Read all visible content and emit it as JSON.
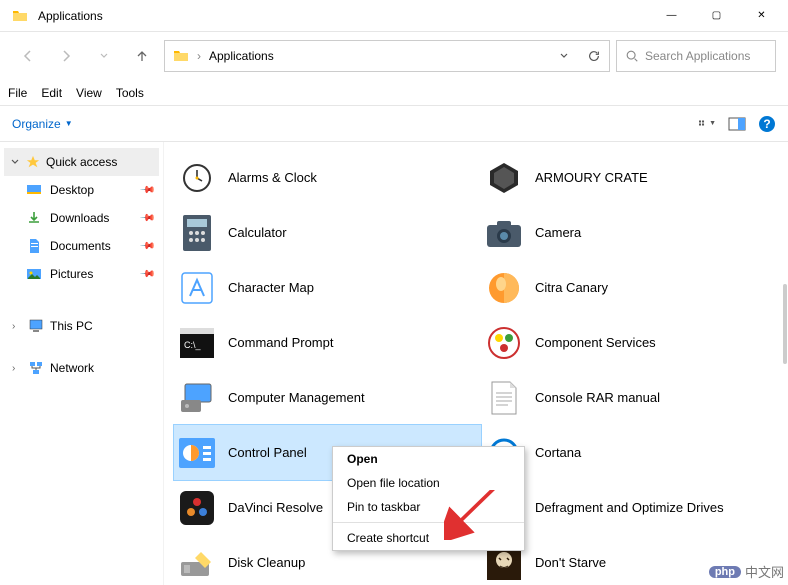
{
  "window": {
    "title": "Applications",
    "minimize": "—",
    "maximize": "▢",
    "close": "✕"
  },
  "nav": {
    "address": "Applications",
    "search_placeholder": "Search Applications"
  },
  "menu": [
    "File",
    "Edit",
    "View",
    "Tools"
  ],
  "toolbar": {
    "organize": "Organize"
  },
  "sidebar": {
    "quick_access": "Quick access",
    "items": [
      {
        "label": "Desktop"
      },
      {
        "label": "Downloads"
      },
      {
        "label": "Documents"
      },
      {
        "label": "Pictures"
      }
    ],
    "this_pc": "This PC",
    "network": "Network"
  },
  "items_col1": [
    {
      "label": "Alarms & Clock"
    },
    {
      "label": "Calculator"
    },
    {
      "label": "Character Map"
    },
    {
      "label": "Command Prompt"
    },
    {
      "label": "Computer Management"
    },
    {
      "label": "Control Panel",
      "selected": true
    },
    {
      "label": "DaVinci Resolve"
    },
    {
      "label": "Disk Cleanup"
    }
  ],
  "items_col2": [
    {
      "label": "ARMOURY CRATE"
    },
    {
      "label": "Camera"
    },
    {
      "label": "Citra Canary"
    },
    {
      "label": "Component Services"
    },
    {
      "label": "Console RAR manual"
    },
    {
      "label": "Cortana"
    },
    {
      "label": "Defragment and Optimize Drives"
    },
    {
      "label": "Don't Starve"
    }
  ],
  "context_menu": {
    "open": "Open",
    "open_location": "Open file location",
    "pin_taskbar": "Pin to taskbar",
    "create_shortcut": "Create shortcut"
  },
  "watermark": "中文网"
}
